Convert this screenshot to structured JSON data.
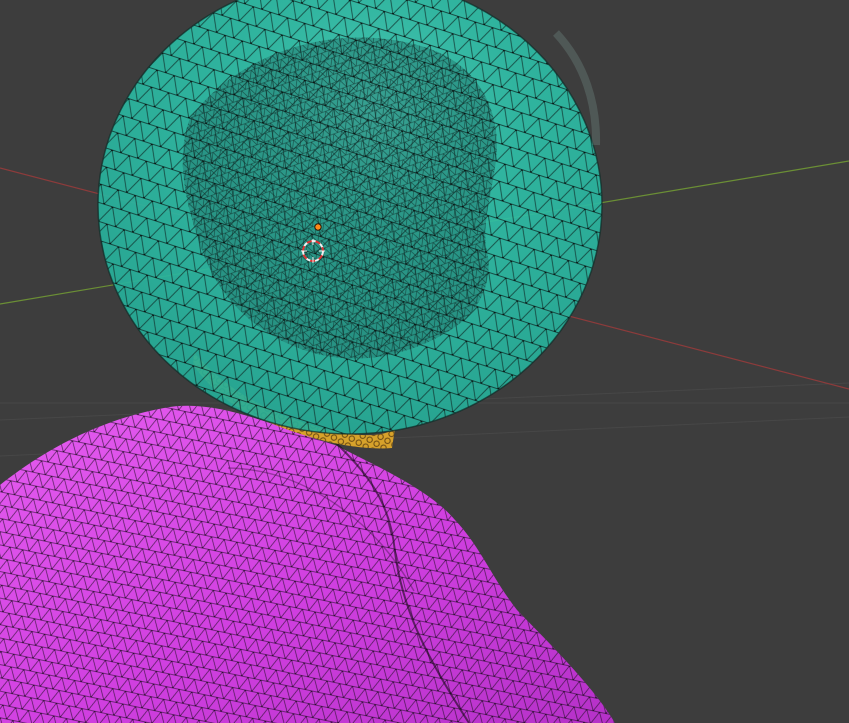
{
  "viewport": {
    "background": "#3d3d3d",
    "x_axis_color": "#8c3b3b",
    "y_axis_color": "#6b8f35",
    "grid_color": "#474747"
  },
  "objects": {
    "helmet": {
      "color": "#2fc0a8",
      "edge_color": "#102b27",
      "state": "edit-mode-mesh"
    },
    "collar": {
      "color": "#d7a22b",
      "state": "mesh"
    },
    "body": {
      "color": "#d33fe2",
      "edge_color": "#1e0c22",
      "state": "edit-mode-mesh"
    }
  },
  "icons": {
    "cursor": "3d-cursor-icon",
    "origin": "object-origin-icon"
  }
}
